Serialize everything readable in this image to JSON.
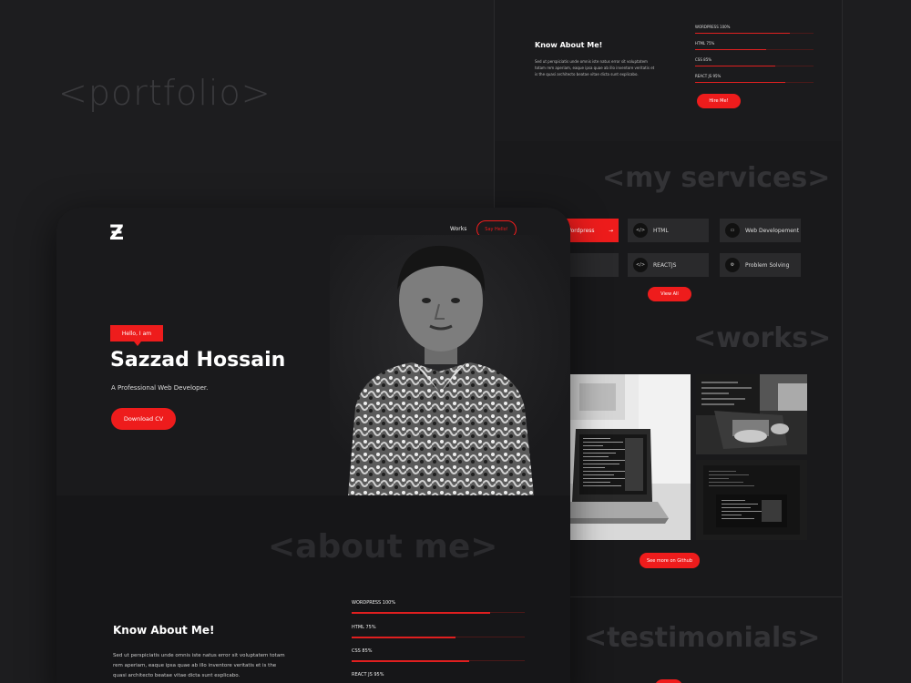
{
  "background": {
    "title": "<portfolio>"
  },
  "right_page": {
    "about": {
      "title": "Know About Me!",
      "text": "Sed ut perspiciatis unde omnis iste natus error sit voluptatem totam rem aperiam, eaque ipsa quae ab illo inventore veritatis et is the quasi architecto beatae vitae dicta sunt explicabo.",
      "skills": [
        {
          "label": "WORDPRESS 100%",
          "value": 100
        },
        {
          "label": "HTML 75%",
          "value": 75
        },
        {
          "label": "CSS 85%",
          "value": 85
        },
        {
          "label": "REACT JS 95%",
          "value": 95
        }
      ],
      "hire_button": "Hire Me!"
    },
    "services": {
      "title": "<my services>",
      "items": [
        {
          "label": "Wordpress",
          "icon": "wordpress-icon",
          "active": true,
          "arrow": "→"
        },
        {
          "label": "HTML",
          "icon": "code-icon",
          "active": false
        },
        {
          "label": "Web Developement",
          "icon": "monitor-icon",
          "active": false
        },
        {
          "label": "",
          "icon": "",
          "active": false
        },
        {
          "label": "REACTJS",
          "icon": "code-icon",
          "active": false
        },
        {
          "label": "Problem Solving",
          "icon": "gear-icon",
          "active": false
        }
      ],
      "view_all": "View All"
    },
    "works": {
      "title": "<works>",
      "github_button": "See more on Github"
    },
    "testimonials": {
      "title": "<testimonials>"
    }
  },
  "main_page": {
    "logo": "Ƶ",
    "nav": {
      "works": "Works",
      "say_hello": "Say Hello!"
    },
    "hero": {
      "badge": "Hello, I am",
      "name": "Sazzad Hossain",
      "subtitle": "A Professional Web Developer.",
      "cta": "Download CV"
    },
    "about": {
      "bg_title": "<about me>",
      "title": "Know About Me!",
      "text": "Sed ut perspiciatis unde omnis iste natus error sit voluptatem  totam rem aperiam, eaque ipsa quae ab illo inventore veritatis et is the quasi architecto beatae vitae dicta sunt explicabo.",
      "skills": [
        {
          "label": "WORDPRESS 100%",
          "value": 100
        },
        {
          "label": "HTML 75%",
          "value": 75
        },
        {
          "label": "CSS 85%",
          "value": 85
        },
        {
          "label": "REACT JS 95%",
          "value": 95
        }
      ]
    }
  },
  "colors": {
    "accent": "#ee1c1c",
    "background": "#1d1d1f"
  }
}
